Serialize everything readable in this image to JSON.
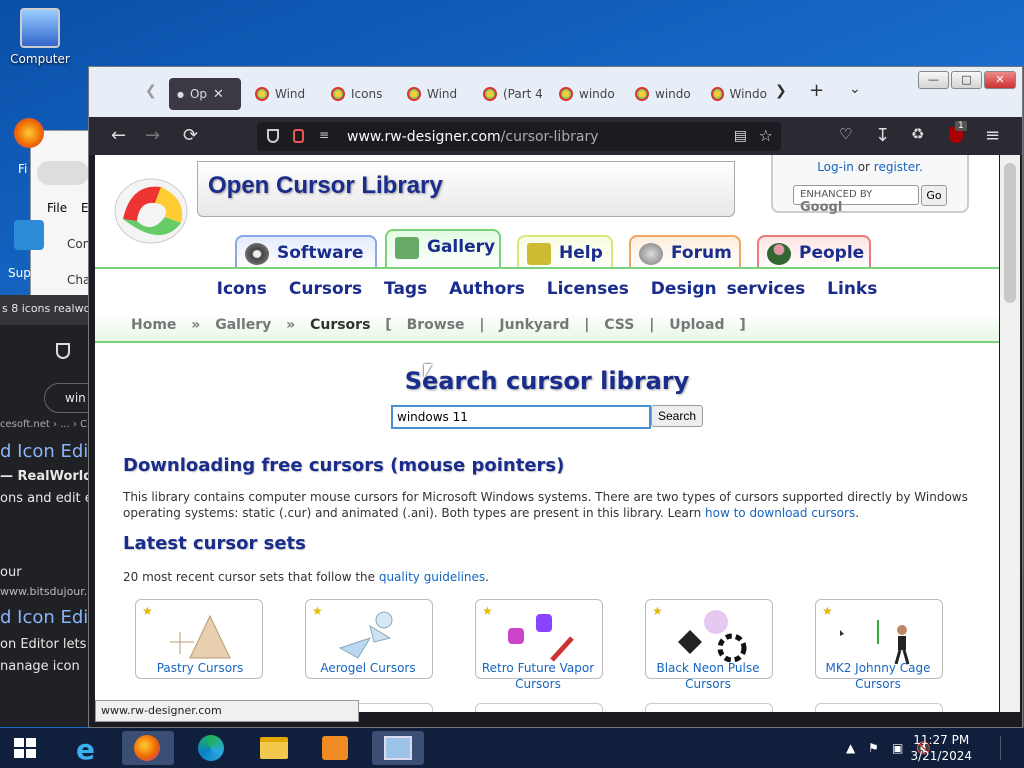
{
  "desktop": {
    "icons": [
      {
        "label": "Computer"
      }
    ]
  },
  "background_windows": {
    "menu_file": "File",
    "menu_e": "E",
    "item_con": "Con",
    "item_cha": "Cha",
    "label_fi": "Fi",
    "label_sup": "Sup",
    "dark_tab_text": "s 8 icons realwor",
    "search_text": "win",
    "url_frag": "cesoft.net › ... › C",
    "result1_title": "d Icon Edit",
    "result1_line1": "— RealWorld",
    "result1_line2": "ons and edit e",
    "result2_line": "our",
    "result2_url": "www.bitsdujour.co",
    "result3_title": "d Icon Edit",
    "result3_line1": "on Editor lets",
    "result3_line2": "nanage icon"
  },
  "browser": {
    "tabs": [
      {
        "label": "Op",
        "active": true
      },
      {
        "label": "Wind"
      },
      {
        "label": "Icons"
      },
      {
        "label": "Wind"
      },
      {
        "label": "(Part 4"
      },
      {
        "label": "windo"
      },
      {
        "label": "windo"
      },
      {
        "label": "Windo"
      }
    ],
    "url_host": "www.rw-designer.com",
    "url_path": "/cursor-library",
    "extension_badge": "1",
    "status_url": "www.rw-designer.com"
  },
  "page": {
    "site_title": "Open Cursor Library",
    "login_link": "Log-in",
    "or_text": " or ",
    "register_link": "register.",
    "gsearch_label": "ENHANCED BY",
    "gsearch_brand": "Googl",
    "go_button": "Go",
    "nav_tabs": [
      {
        "label": "Software",
        "color": "#8aa8e8"
      },
      {
        "label": "Gallery",
        "color": "#7cd27c"
      },
      {
        "label": "Help",
        "color": "#d6e87c"
      },
      {
        "label": "Forum",
        "color": "#f0a860"
      },
      {
        "label": "People",
        "color": "#e87c7c"
      }
    ],
    "main_nav": [
      "Icons",
      "Cursors",
      "Tags",
      "Authors",
      "Licenses",
      "Design services",
      "Links"
    ],
    "breadcrumb": {
      "home": "Home",
      "sep": "»",
      "gallery": "Gallery",
      "current": "Cursors",
      "open_bracket": "[",
      "close_bracket": "]",
      "pipe": "|",
      "sub": [
        "Browse",
        "Junkyard",
        "CSS",
        "Upload"
      ]
    },
    "search_title": "Search cursor library",
    "search_value": "windows 11",
    "search_button": "Search",
    "heading1": "Downloading free cursors (mouse pointers)",
    "para1_a": "This library contains computer mouse cursors for Microsoft Windows systems. There are two types of cursors supported directly by Windows operating systems: static (.cur) and animated (.ani). Both types are present in this library. Learn ",
    "para1_link": "how to download cursors",
    "para1_end": ".",
    "heading2": "Latest cursor sets",
    "para2_a": "20 most recent cursor sets that follow the ",
    "para2_link": "quality guidelines",
    "para2_end": ".",
    "cursor_sets": [
      {
        "name": "Pastry Cursors"
      },
      {
        "name": "Aerogel Cursors"
      },
      {
        "name": "Retro Future Vapor Cursors"
      },
      {
        "name": "Black Neon Pulse Cursors"
      },
      {
        "name": "MK2 Johnny Cage Cursors"
      }
    ]
  },
  "taskbar": {
    "time": "11:27 PM",
    "date": "3/21/2024"
  }
}
